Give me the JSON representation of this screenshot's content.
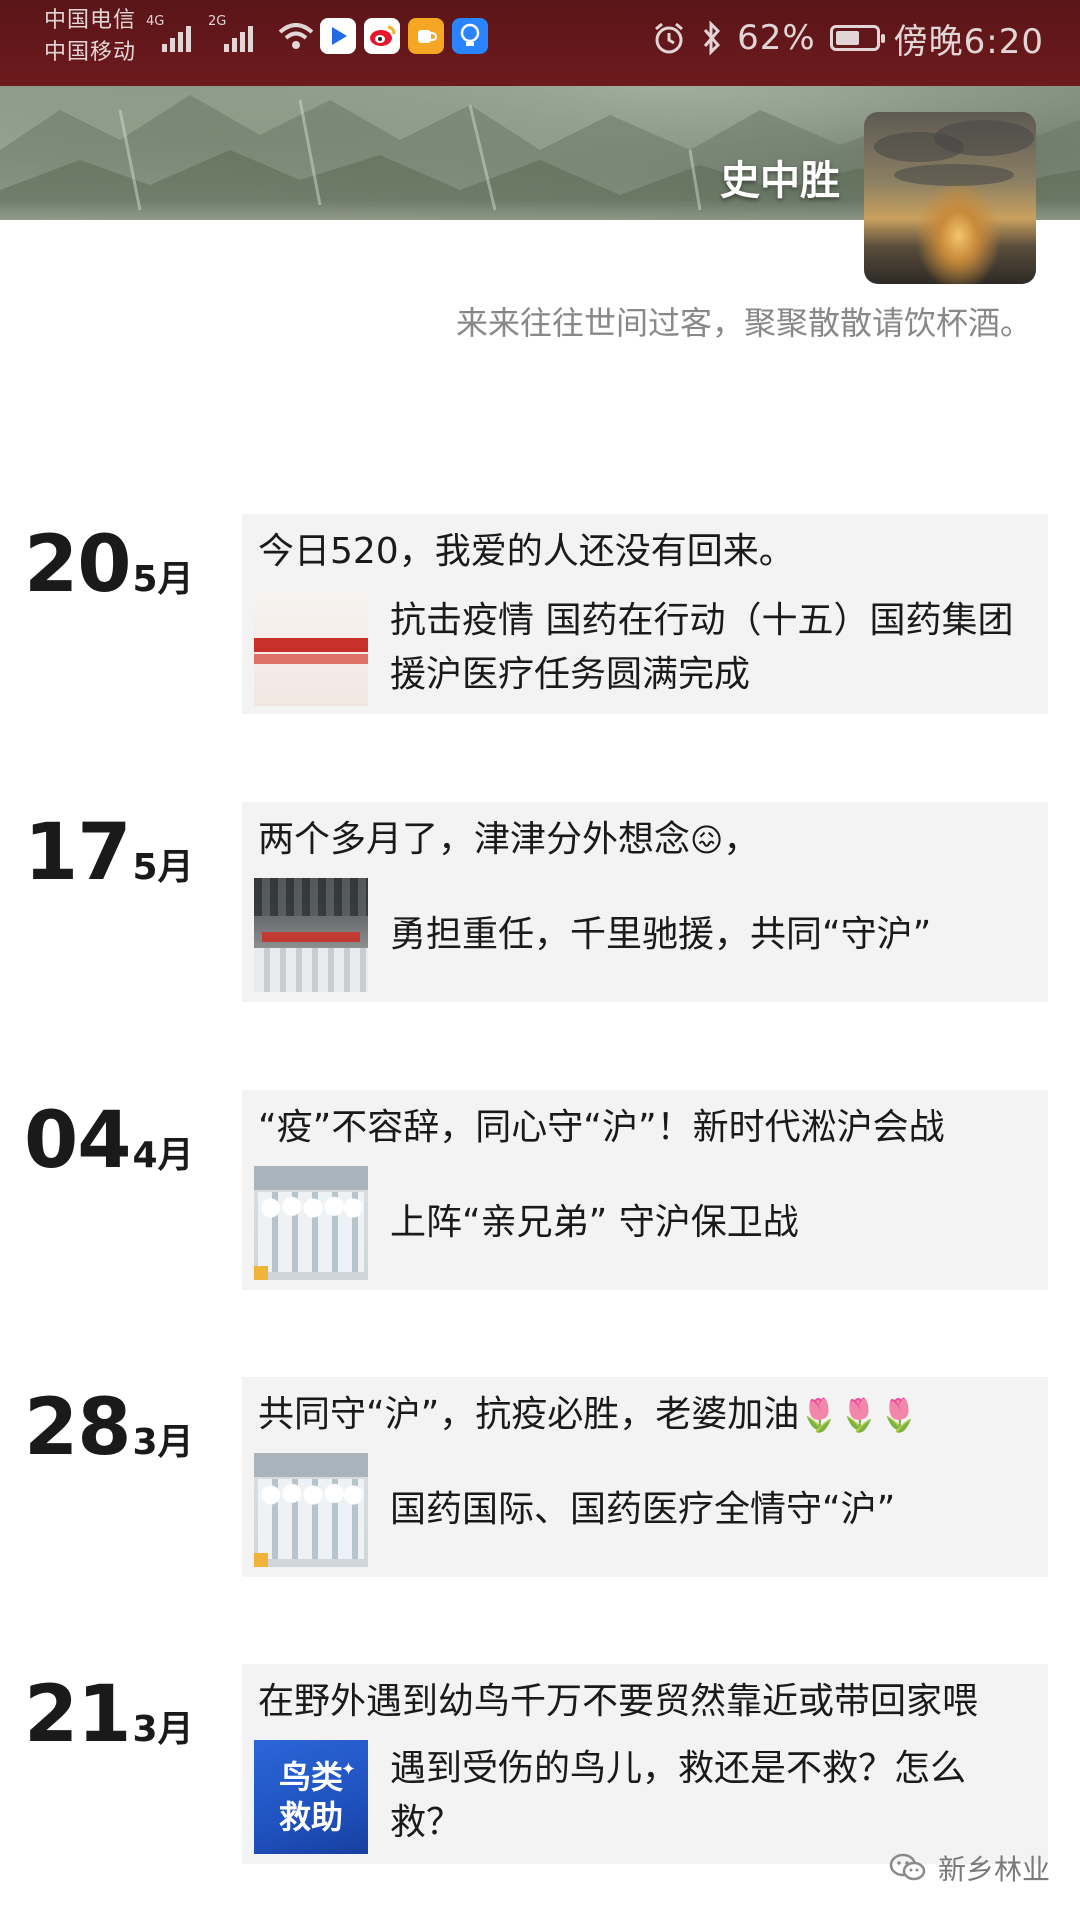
{
  "status_bar": {
    "carrier_1": "中国电信",
    "carrier_2": "中国移动",
    "network_1": "4G",
    "network_2": "2G",
    "apps": [
      {
        "icon": "video-app-icon",
        "color": "#1f6ae0"
      },
      {
        "icon": "weibo-icon",
        "color": "#f2b233"
      },
      {
        "icon": "cup-app-icon",
        "color": "#f5a623"
      },
      {
        "icon": "bulb-app-icon",
        "color": "#2a84ff"
      }
    ],
    "battery_percent": "62%",
    "battery_level": 0.62,
    "time": "傍晚6:20"
  },
  "profile": {
    "name": "史中胜",
    "signature": "来来往往世间过客，聚聚散散请饮杯酒。"
  },
  "posts": [
    {
      "day": "20",
      "month": "5月",
      "text": "今日520，我爱的人还没有回来。",
      "link_title": "抗击疫情 国药在行动（十五）国药集团援沪医疗任务圆满完成",
      "thumb": "banner-thumbnail"
    },
    {
      "day": "17",
      "month": "5月",
      "text": "两个多月了，津津分外想念",
      "emoji": "😖",
      "text_tail": "，",
      "link_title": "勇担重任，千里驰援，共同“守沪”",
      "thumb": "hall-thumbnail"
    },
    {
      "day": "04",
      "month": "4月",
      "text": "“疫”不容辞，同心守“沪”！新时代淞沪会战",
      "link_title": "上阵“亲兄弟” 守沪保卫战",
      "thumb": "team-thumbnail"
    },
    {
      "day": "28",
      "month": "3月",
      "text": "共同守“沪”，抗疫必胜，老婆加油",
      "emoji": "🌷🌷🌷",
      "link_title": "国药国际、国药医疗全情守“沪”",
      "thumb": "team-thumbnail"
    },
    {
      "day": "21",
      "month": "3月",
      "text": "在野外遇到幼鸟千万不要贸然靠近或带回家喂",
      "link_title": "遇到受伤的鸟儿，救还是不救？怎么救？",
      "thumb": "bird-thumbnail",
      "thumb_line1": "鸟类",
      "thumb_line2": "救助"
    }
  ],
  "watermark": {
    "icon": "wechat-icon",
    "text": "新乡林业"
  }
}
